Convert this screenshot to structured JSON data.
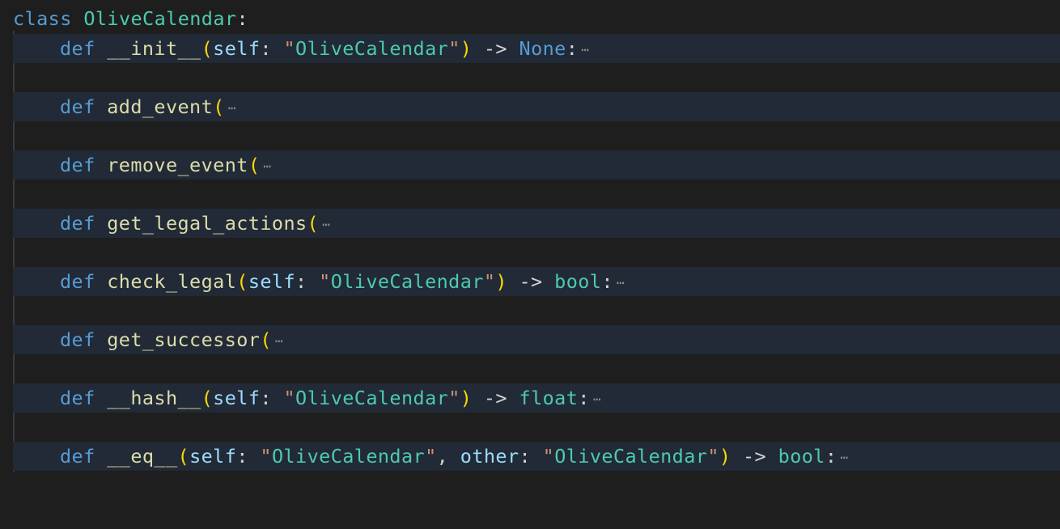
{
  "editor": {
    "class_keyword": "class",
    "class_name": "OliveCalendar",
    "colon": ":",
    "def_keyword": "def",
    "fold_marker": "⋯",
    "methods": [
      {
        "name": "__init__",
        "open_paren": "(",
        "self": "self",
        "self_sep": ": ",
        "self_type": "OliveCalendar",
        "close_paren": ")",
        "arrow": " -> ",
        "return_type": "None",
        "colon": ":"
      },
      {
        "name": "add_event",
        "open_paren": "("
      },
      {
        "name": "remove_event",
        "open_paren": "("
      },
      {
        "name": "get_legal_actions",
        "open_paren": "("
      },
      {
        "name": "check_legal",
        "open_paren": "(",
        "self": "self",
        "self_sep": ": ",
        "self_type": "OliveCalendar",
        "close_paren": ")",
        "arrow": " -> ",
        "return_type": "bool",
        "colon": ":"
      },
      {
        "name": "get_successor",
        "open_paren": "("
      },
      {
        "name": "__hash__",
        "open_paren": "(",
        "self": "self",
        "self_sep": ": ",
        "self_type": "OliveCalendar",
        "close_paren": ")",
        "arrow": " -> ",
        "return_type": "float",
        "colon": ":"
      },
      {
        "name": "__eq__",
        "open_paren": "(",
        "self": "self",
        "self_sep": ": ",
        "self_type": "OliveCalendar",
        "comma": ", ",
        "other": "other",
        "other_sep": ": ",
        "other_type": "OliveCalendar",
        "close_paren": ")",
        "arrow": " -> ",
        "return_type": "bool",
        "colon": ":"
      }
    ]
  },
  "colors": {
    "background": "#1e1e1e",
    "folded_line_bg": "#212a36",
    "keyword": "#569cd6",
    "class_name": "#4ec9b0",
    "function": "#dcdcaa",
    "bracket": "#ffd700",
    "parameter": "#9cdcfe",
    "string": "#4ec9b0"
  }
}
